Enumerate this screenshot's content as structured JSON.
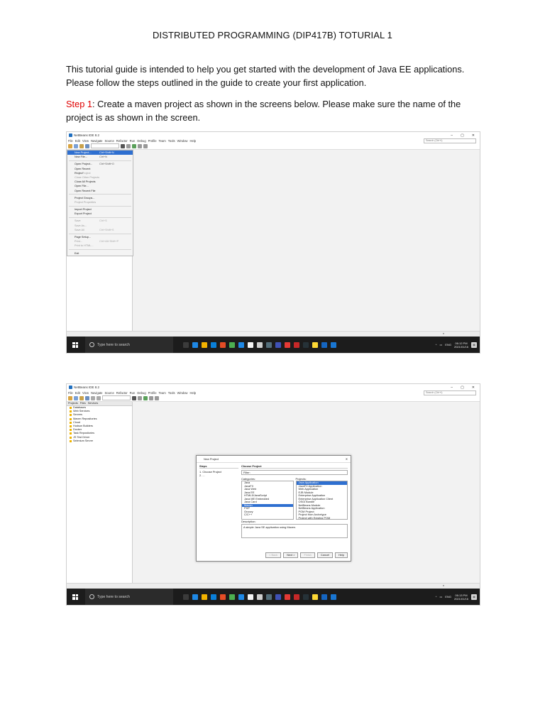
{
  "document": {
    "title": "DISTRIBUTED PROGRAMMING (DIP417B) TOTURIAL 1",
    "intro_line1": "This tutorial guide is intended to help you get started with the development of Java EE applications.",
    "intro_line2": "Please follow the steps outlined in the guide to create your first application.",
    "step_label": "Step 1",
    "step_text_line1": ": Create a maven project as shown in the screens below. Please make sure the name of the",
    "step_text_line2": "project is as shown in the screen.",
    "step_color": "#e00000"
  },
  "screenshot1": {
    "window_title": "NetBeans IDE 8.2",
    "menubar": [
      "File",
      "Edit",
      "View",
      "Navigate",
      "Source",
      "Refactor",
      "Run",
      "Debug",
      "Profile",
      "Team",
      "Tools",
      "Window",
      "Help"
    ],
    "search_placeholder": "Search (Ctrl+I)",
    "file_menu": [
      {
        "label": "New Project...",
        "shortcut": "Ctrl+Shift+N",
        "state": "selected"
      },
      {
        "label": "New File...",
        "shortcut": "Ctrl+N",
        "state": "normal"
      },
      {
        "sep": true
      },
      {
        "label": "Open Project...",
        "shortcut": "Ctrl+Shift+O",
        "state": "normal"
      },
      {
        "label": "Open Recent Project",
        "shortcut": "",
        "state": "normal"
      },
      {
        "label": "Close Project",
        "shortcut": "",
        "state": "disabled"
      },
      {
        "label": "Close Other Projects",
        "shortcut": "",
        "state": "disabled"
      },
      {
        "label": "Close All Projects",
        "shortcut": "",
        "state": "normal"
      },
      {
        "label": "Open File...",
        "shortcut": "",
        "state": "normal"
      },
      {
        "label": "Open Recent File",
        "shortcut": "",
        "state": "normal"
      },
      {
        "sep": true
      },
      {
        "label": "Project Groups...",
        "shortcut": "",
        "state": "normal"
      },
      {
        "label": "Project Properties",
        "shortcut": "",
        "state": "disabled"
      },
      {
        "sep": true
      },
      {
        "label": "Import Project",
        "shortcut": "",
        "state": "normal"
      },
      {
        "label": "Export Project",
        "shortcut": "",
        "state": "normal"
      },
      {
        "sep": true
      },
      {
        "label": "Save",
        "shortcut": "Ctrl+S",
        "state": "disabled"
      },
      {
        "label": "Save As...",
        "shortcut": "",
        "state": "disabled"
      },
      {
        "label": "Save All",
        "shortcut": "Ctrl+Shift+S",
        "state": "disabled"
      },
      {
        "sep": true
      },
      {
        "label": "Page Setup...",
        "shortcut": "",
        "state": "normal"
      },
      {
        "label": "Print...",
        "shortcut": "Ctrl+Alt+Shift+P",
        "state": "disabled"
      },
      {
        "label": "Print to HTML...",
        "shortcut": "",
        "state": "disabled"
      },
      {
        "sep": true
      },
      {
        "label": "Exit",
        "shortcut": "",
        "state": "normal"
      }
    ],
    "taskbar_search": "Type here to search",
    "clock_time": "06:12 PM",
    "clock_date": "2021/01/16",
    "lang": "ENG"
  },
  "screenshot2": {
    "window_title": "NetBeans IDE 8.2",
    "menubar": [
      "File",
      "Edit",
      "View",
      "Navigate",
      "Source",
      "Refactor",
      "Run",
      "Debug",
      "Profile",
      "Team",
      "Tools",
      "Window",
      "Help"
    ],
    "search_placeholder": "Search (Ctrl+I)",
    "panel_tabs": [
      "Projects",
      "Files",
      "Services"
    ],
    "services": [
      "Databases",
      "Web Services",
      "Servers",
      "Maven Repositories",
      "Cloud",
      "Hudson Builders",
      "Docker",
      "Task Repositories",
      "JS Test Driver",
      "Selenium Server"
    ],
    "dialog": {
      "title": "New Project",
      "steps_heading": "Steps",
      "steps": [
        "1.  Choose Project",
        "2.  ..."
      ],
      "main_heading": "Choose Project",
      "filter_label": "Filter:",
      "categories_label": "Categories:",
      "projects_label": "Projects:",
      "categories": [
        "Java",
        "JavaFX",
        "Java Web",
        "Java EE",
        "HTML5/JavaScript",
        "Java ME Embedded",
        "Java Card",
        "Maven",
        "PHP",
        "Groovy",
        "C/C++"
      ],
      "selected_category": "Maven",
      "projects": [
        "Java Application",
        "JavaFX Application",
        "Web Application",
        "EJB Module",
        "Enterprise Application",
        "Enterprise Application Client",
        "OSGi Bundle",
        "NetBeans Module",
        "NetBeans Application",
        "POM Project",
        "Project from Archetype",
        "Project with Existing POM"
      ],
      "selected_project": "Java Application",
      "description_label": "Description:",
      "description": "A simple Java SE application using Maven.",
      "buttons": [
        "< Back",
        "Next >",
        "Finish",
        "Cancel",
        "Help"
      ]
    },
    "taskbar_search": "Type here to search",
    "clock_time": "06:13 PM",
    "clock_date": "2021/01/16",
    "lang": "ENG"
  },
  "taskbar_icons": [
    "#3b3b3b",
    "#1e88e5",
    "#f2b200",
    "#0a7fd8",
    "#e44d26",
    "#4caf50",
    "#1e88e5",
    "#f5f5f5",
    "#cfcfcf",
    "#546e7a",
    "#3f51b5",
    "#e53935",
    "#c62828",
    "#263238",
    "#fdd835",
    "#1565c0",
    "#1976d2"
  ]
}
